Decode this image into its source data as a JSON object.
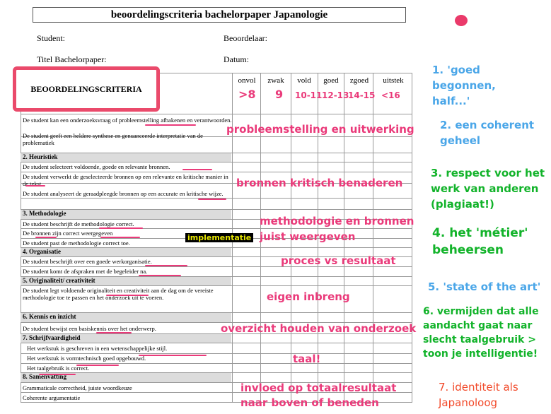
{
  "doc": {
    "title": "beoordelingscriteria bachelorpaper Japanologie",
    "student_label": "Student:",
    "beoordelaar_label": "Beoordelaar:",
    "titel_label": "Titel Bachelorpaper:",
    "datum_label": "Datum:",
    "criteria_header": "BEOORDELINGSCRITERIA"
  },
  "columns": [
    "onvol",
    "zwak",
    "vold",
    "goed",
    "zgoed",
    "uitstek"
  ],
  "grade_marks": [
    ">8",
    "9",
    "10-11",
    "12-13",
    "14-15",
    "<16"
  ],
  "sections": {
    "s2": "2. Heuristiek",
    "s3": "3. Methodologie",
    "s4": "4. Organisatie",
    "s5": "5. Originaliteit/ creativiteit",
    "s6": "6. Kennis en inzicht",
    "s7": "7. Schrijfvaardigheid",
    "s8": "8. Samenvatting"
  },
  "criteria": {
    "c1a": "De student kan een onderzoeksvraag of probleemstelling afbakenen en verantwoorden.",
    "c1b": "De student geeft een heldere synthese en genuanceerde interpretatie van de problematiek",
    "c2a": "De student selecteert voldoende, goede en relevante bronnen.",
    "c2b": "De student verwerkt de geselecteerde bronnen op een relevante en kritische manier in de tekst.",
    "c2c": "De student analyseert de geraadpleegde bronnen op een accurate en kritische wijze.",
    "c3a": "De student beschrijft de methodologie correct.",
    "c3b": "De bronnen zijn correct weergegeven",
    "c3c": "De student past de methodologie correct toe.",
    "c4a": "De student beschrijft over een goede werkorganisatie.",
    "c4b": "De student komt de afspraken met de begeleider na.",
    "c5a": "De student legt voldoende originaliteit en creativiteit aan de dag om de vereiste methodologie toe te passen en het onderzoek uit te voeren.",
    "c6a": "De student bewijst een basiskennis over het onderwerp.",
    "c7a": "Het werkstuk is geschreven in een wetenschappelijke stijl.",
    "c7b": "Het werkstuk is vormtechnisch goed opgebouwd.",
    "c7c": "Het taalgebruik is correct.",
    "c8a": "Grammaticale correctheid, juiste woordkeuze",
    "c8b": "Coherente argumentatie"
  },
  "annotations": {
    "probleemstelling": "probleemstelling en uitwerking",
    "bronnen": "bronnen kritisch benaderen",
    "methodologie1": "methodologie en bronnen",
    "methodologie2": "juist weergeven",
    "implementatie": "implementatie",
    "proces": "proces vs resultaat",
    "inbreng": "eigen inbreng",
    "overzicht": "overzicht houden van onderzoek",
    "taal": "taal!",
    "invloed1": "invloed op totaalresultaat",
    "invloed2": "naar boven of beneden"
  },
  "side_notes": {
    "n1a": "1. 'goed",
    "n1b": "begonnen,",
    "n1c": "half...'",
    "n2a": "2. een coherent",
    "n2b": "geheel",
    "n3a": "3. respect voor het",
    "n3b": "werk van anderen",
    "n3c": "(plagiaat!)",
    "n4a": "4. het 'métier'",
    "n4b": "beheersen",
    "n5": "5. 'state of the art'",
    "n6a": "6. vermijden dat alle",
    "n6b": "aandacht gaat naar",
    "n6c": "slecht taalgebruik >",
    "n6d": "toon je intelligentie!",
    "n7a": "7. identiteit als",
    "n7b": "Japanoloog"
  },
  "colors": {
    "pink": "#ea3a7a",
    "blue": "#4aa6e8",
    "green": "#12b32a",
    "red": "#f24a2a"
  }
}
